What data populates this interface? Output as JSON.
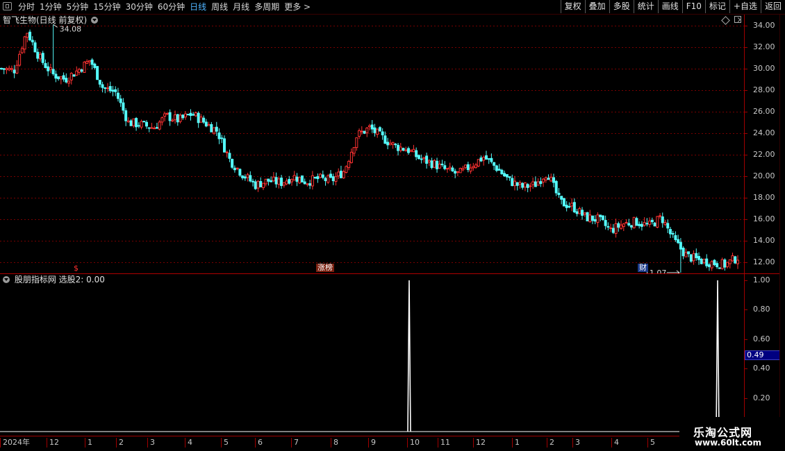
{
  "toolbar": {
    "periods": [
      "分时",
      "1分钟",
      "5分钟",
      "15分钟",
      "30分钟",
      "60分钟",
      "日线",
      "周线",
      "月线",
      "多周期",
      "更多 >"
    ],
    "active_period": "日线",
    "buttons": [
      "复权",
      "叠加",
      "多股",
      "统计",
      "画线",
      "F10",
      "标记",
      "+自选",
      "返回"
    ]
  },
  "price_pane": {
    "title": "智飞生物(日线 前复权)",
    "y_ticks": [
      "34.00",
      "32.00",
      "30.00",
      "28.00",
      "26.00",
      "24.00",
      "22.00",
      "20.00",
      "18.00",
      "16.00",
      "14.00",
      "12.00"
    ],
    "high_label": "34.08",
    "low_label": "11.07",
    "markers": {
      "s": "$",
      "zb": "涨榜",
      "cai": "财"
    }
  },
  "indicator_pane": {
    "title": "股朋指标网 选股2: 0.00",
    "y_ticks": [
      "1.00",
      "0.80",
      "0.60",
      "0.40",
      "0.20"
    ],
    "current_value": "0.49"
  },
  "date_axis": [
    "2024年",
    "12",
    "1",
    "2",
    "3",
    "4",
    "5",
    "6",
    "7",
    "8",
    "9",
    "10",
    "11",
    "12",
    "1",
    "2",
    "3",
    "4",
    "5"
  ],
  "watermark": {
    "title": "乐淘公式网",
    "url": "www.60lt.com"
  },
  "colors": {
    "up": "#ff3232",
    "down": "#54fcfc",
    "grid": "#7a0000",
    "active": "#4fb4ff"
  },
  "chart_data": {
    "type": "candlestick",
    "y_range": [
      11,
      35
    ],
    "trend_close": [
      30.0,
      29.8,
      33.5,
      31.0,
      29.5,
      29.0,
      29.8,
      30.8,
      28.2,
      27.8,
      25.0,
      24.8,
      24.5,
      25.6,
      25.2,
      25.8,
      25.0,
      24.2,
      21.5,
      20.2,
      19.2,
      19.6,
      19.4,
      20.0,
      19.5,
      19.8,
      19.6,
      20.5,
      23.8,
      24.5,
      23.6,
      22.8,
      22.5,
      21.6,
      21.2,
      20.6,
      20.2,
      21.0,
      21.8,
      20.8,
      19.6,
      19.0,
      19.2,
      20.4,
      17.6,
      17.2,
      16.2,
      16.0,
      15.0,
      15.6,
      15.8,
      15.4,
      16.2,
      14.0,
      12.6,
      12.2,
      12.0,
      11.8,
      12.5
    ],
    "indicator_signals": [
      {
        "x_label": "10",
        "value": 1.0
      },
      {
        "x_label": "5",
        "value": 1.0
      }
    ]
  }
}
